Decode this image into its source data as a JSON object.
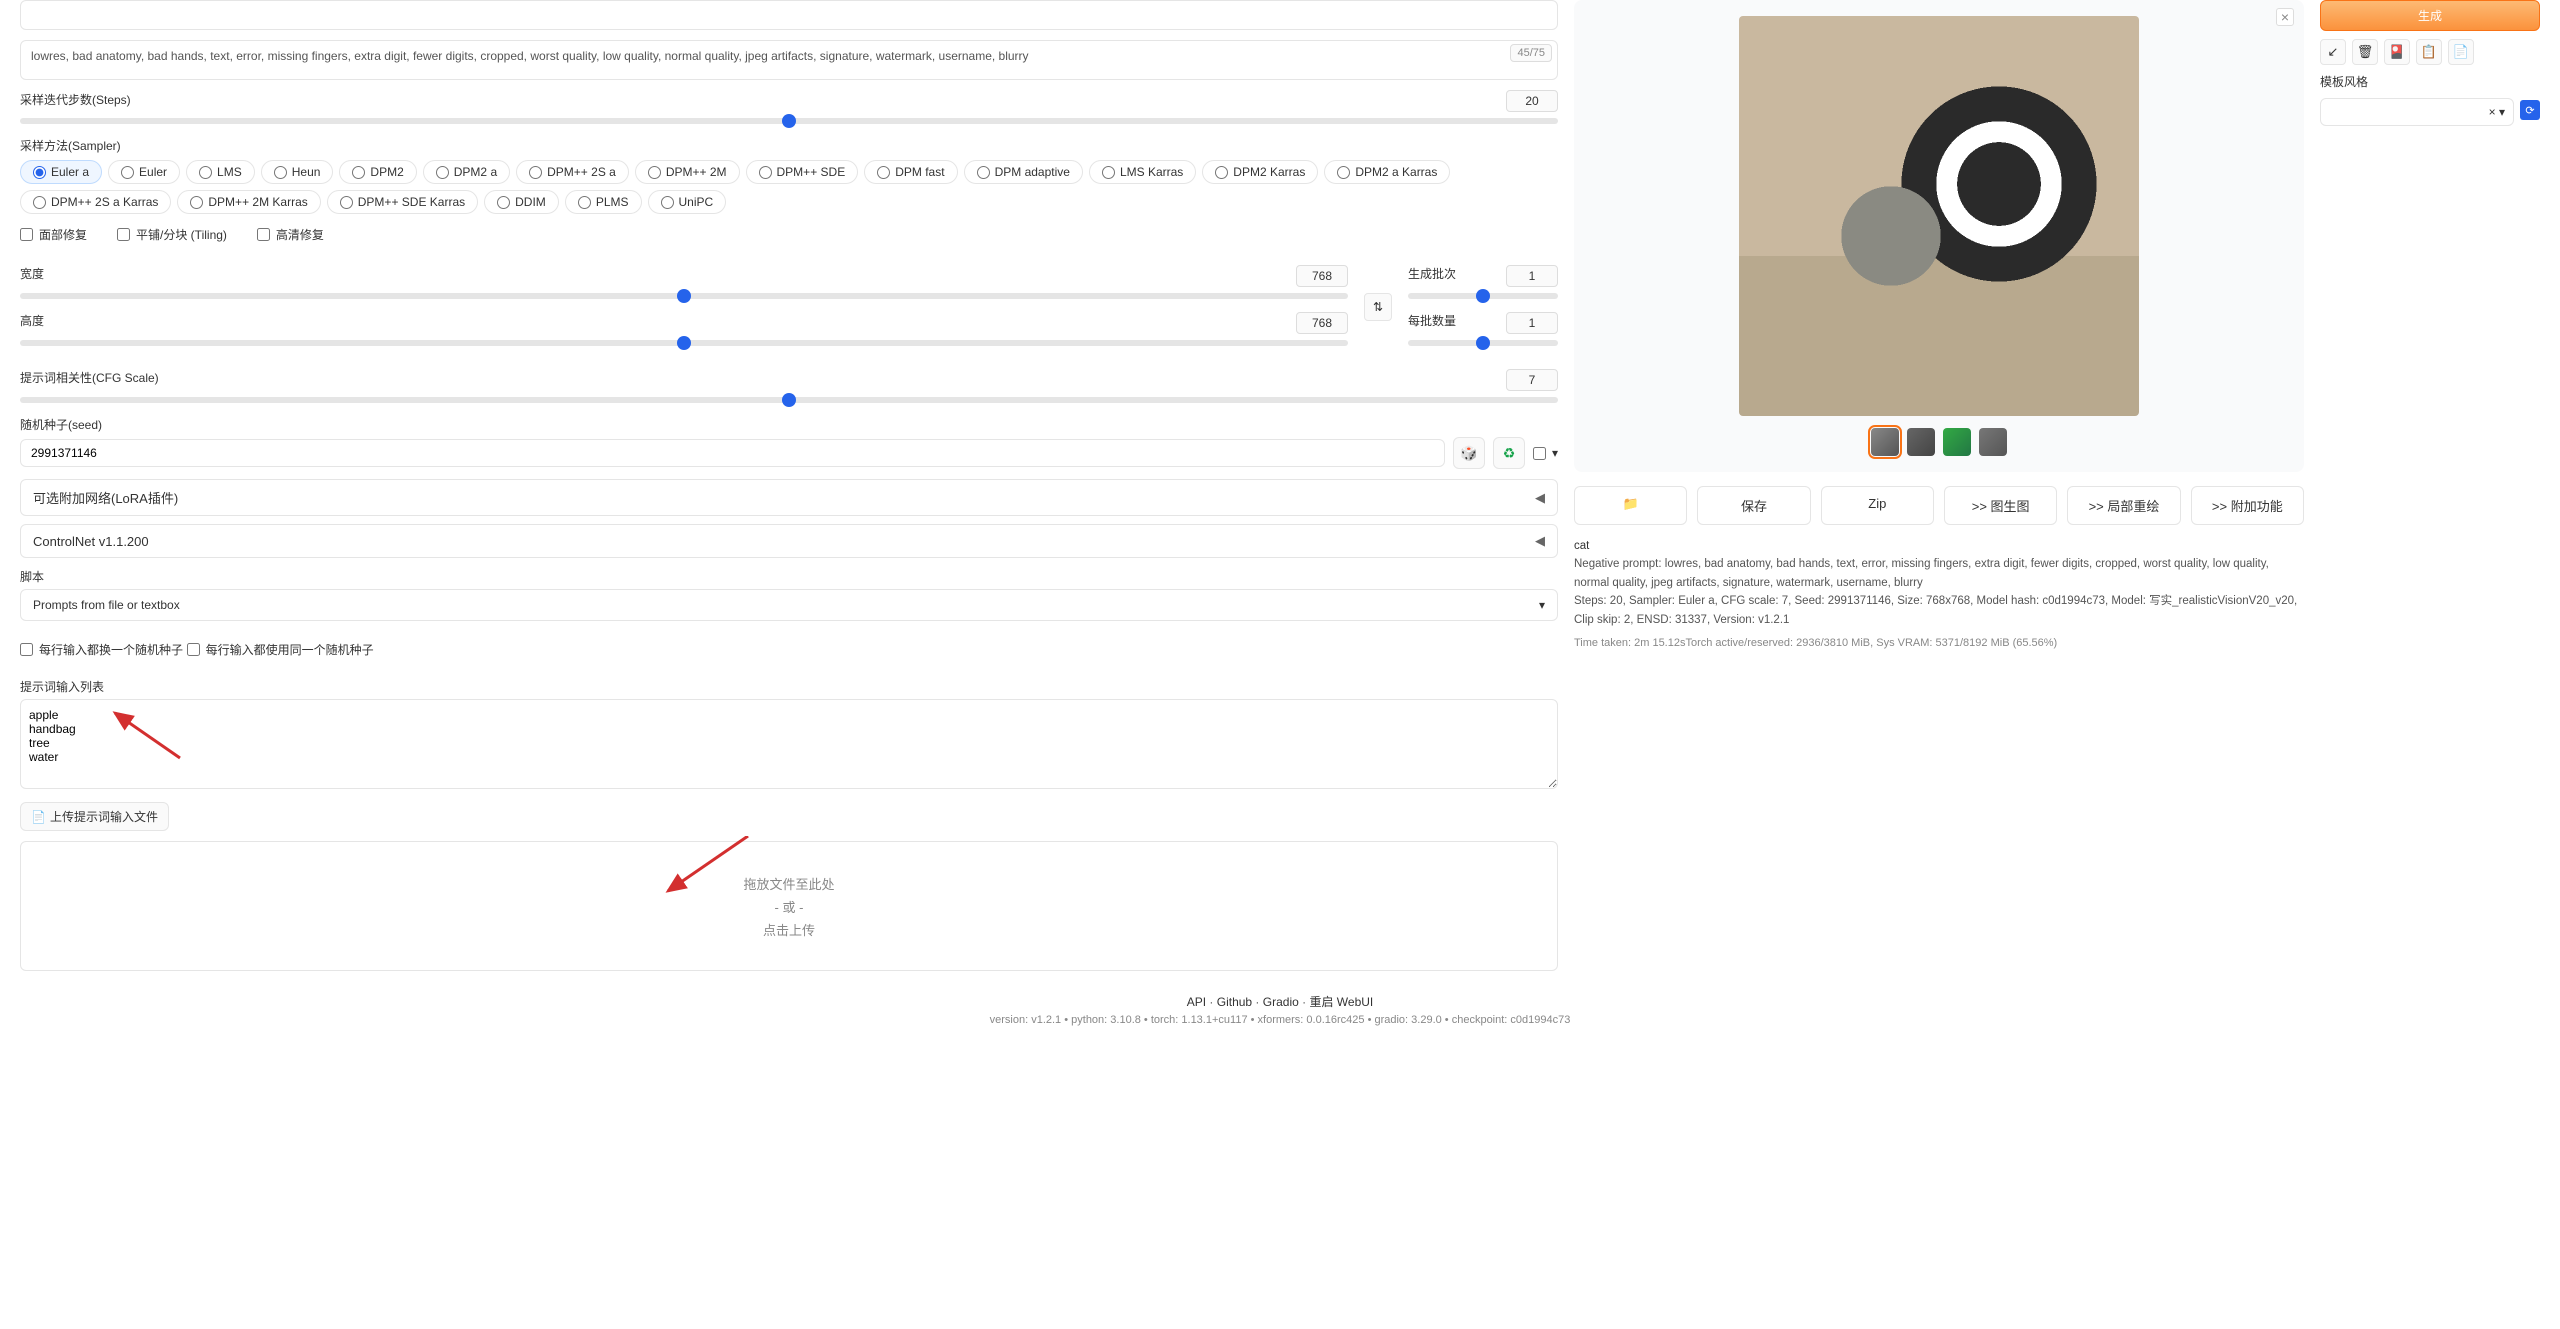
{
  "positive_prompt": "",
  "negative_prompt": "lowres, bad anatomy, bad hands, text, error, missing fingers, extra digit, fewer digits, cropped, worst quality, low quality, normal quality, jpeg artifacts, signature, watermark, username, blurry",
  "token_count": "45/75",
  "steps": {
    "label": "采样迭代步数(Steps)",
    "value": "20"
  },
  "sampler": {
    "label": "采样方法(Sampler)",
    "options": [
      "Euler a",
      "Euler",
      "LMS",
      "Heun",
      "DPM2",
      "DPM2 a",
      "DPM++ 2S a",
      "DPM++ 2M",
      "DPM++ SDE",
      "DPM fast",
      "DPM adaptive",
      "LMS Karras",
      "DPM2 Karras",
      "DPM2 a Karras",
      "DPM++ 2S a Karras",
      "DPM++ 2M Karras",
      "DPM++ SDE Karras",
      "DDIM",
      "PLMS",
      "UniPC"
    ],
    "selected": "Euler a"
  },
  "checks": {
    "face": "面部修复",
    "tiling": "平铺/分块 (Tiling)",
    "hires": "高清修复"
  },
  "width": {
    "label": "宽度",
    "value": "768"
  },
  "height": {
    "label": "高度",
    "value": "768"
  },
  "batch_count": {
    "label": "生成批次",
    "value": "1"
  },
  "batch_size": {
    "label": "每批数量",
    "value": "1"
  },
  "cfg": {
    "label": "提示词相关性(CFG Scale)",
    "value": "7"
  },
  "seed": {
    "label": "随机种子(seed)",
    "value": "2991371146"
  },
  "lora": "可选附加网络(LoRA插件)",
  "controlnet": "ControlNet v1.1.200",
  "script": {
    "label": "脚本",
    "selected": "Prompts from file or textbox"
  },
  "script_opts": {
    "iterate": "每行输入都换一个随机种子",
    "same_seed": "每行输入都使用同一个随机种子"
  },
  "prompt_list_label": "提示词输入列表",
  "prompt_list": "apple\nhandbag\ntree\nwater",
  "upload_btn": "上传提示词输入文件",
  "dropzone": {
    "l1": "拖放文件至此处",
    "l2": "- 或 -",
    "l3": "点击上传"
  },
  "far_right": {
    "orange": "生成",
    "style_label": "模板风格"
  },
  "actions": {
    "folder": "📁",
    "save": "保存",
    "zip": "Zip",
    "img2img": ">> 图生图",
    "inpaint": ">> 局部重绘",
    "extras": ">> 附加功能"
  },
  "info": {
    "prompt": "cat",
    "neg_label": "Negative prompt: ",
    "neg": "lowres, bad anatomy, bad hands, text, error, missing fingers, extra digit, fewer digits, cropped, worst quality, low quality, normal quality, jpeg artifacts, signature, watermark, username, blurry",
    "params": "Steps: 20, Sampler: Euler a, CFG scale: 7, Seed: 2991371146, Size: 768x768, Model hash: c0d1994c73, Model: 写实_realisticVisionV20_v20, Clip skip: 2, ENSD: 31337, Version: v1.2.1",
    "sys": "Time taken: 2m 15.12sTorch active/reserved: 2936/3810 MiB, Sys VRAM: 5371/8192 MiB (65.56%)"
  },
  "footer": {
    "links": [
      "API",
      "Github",
      "Gradio",
      "重启 WebUI"
    ],
    "ver": "version: v1.2.1  •  python: 3.10.8  •  torch: 1.13.1+cu117  •  xformers: 0.0.16rc425  •  gradio: 3.29.0  •  checkpoint: c0d1994c73"
  }
}
